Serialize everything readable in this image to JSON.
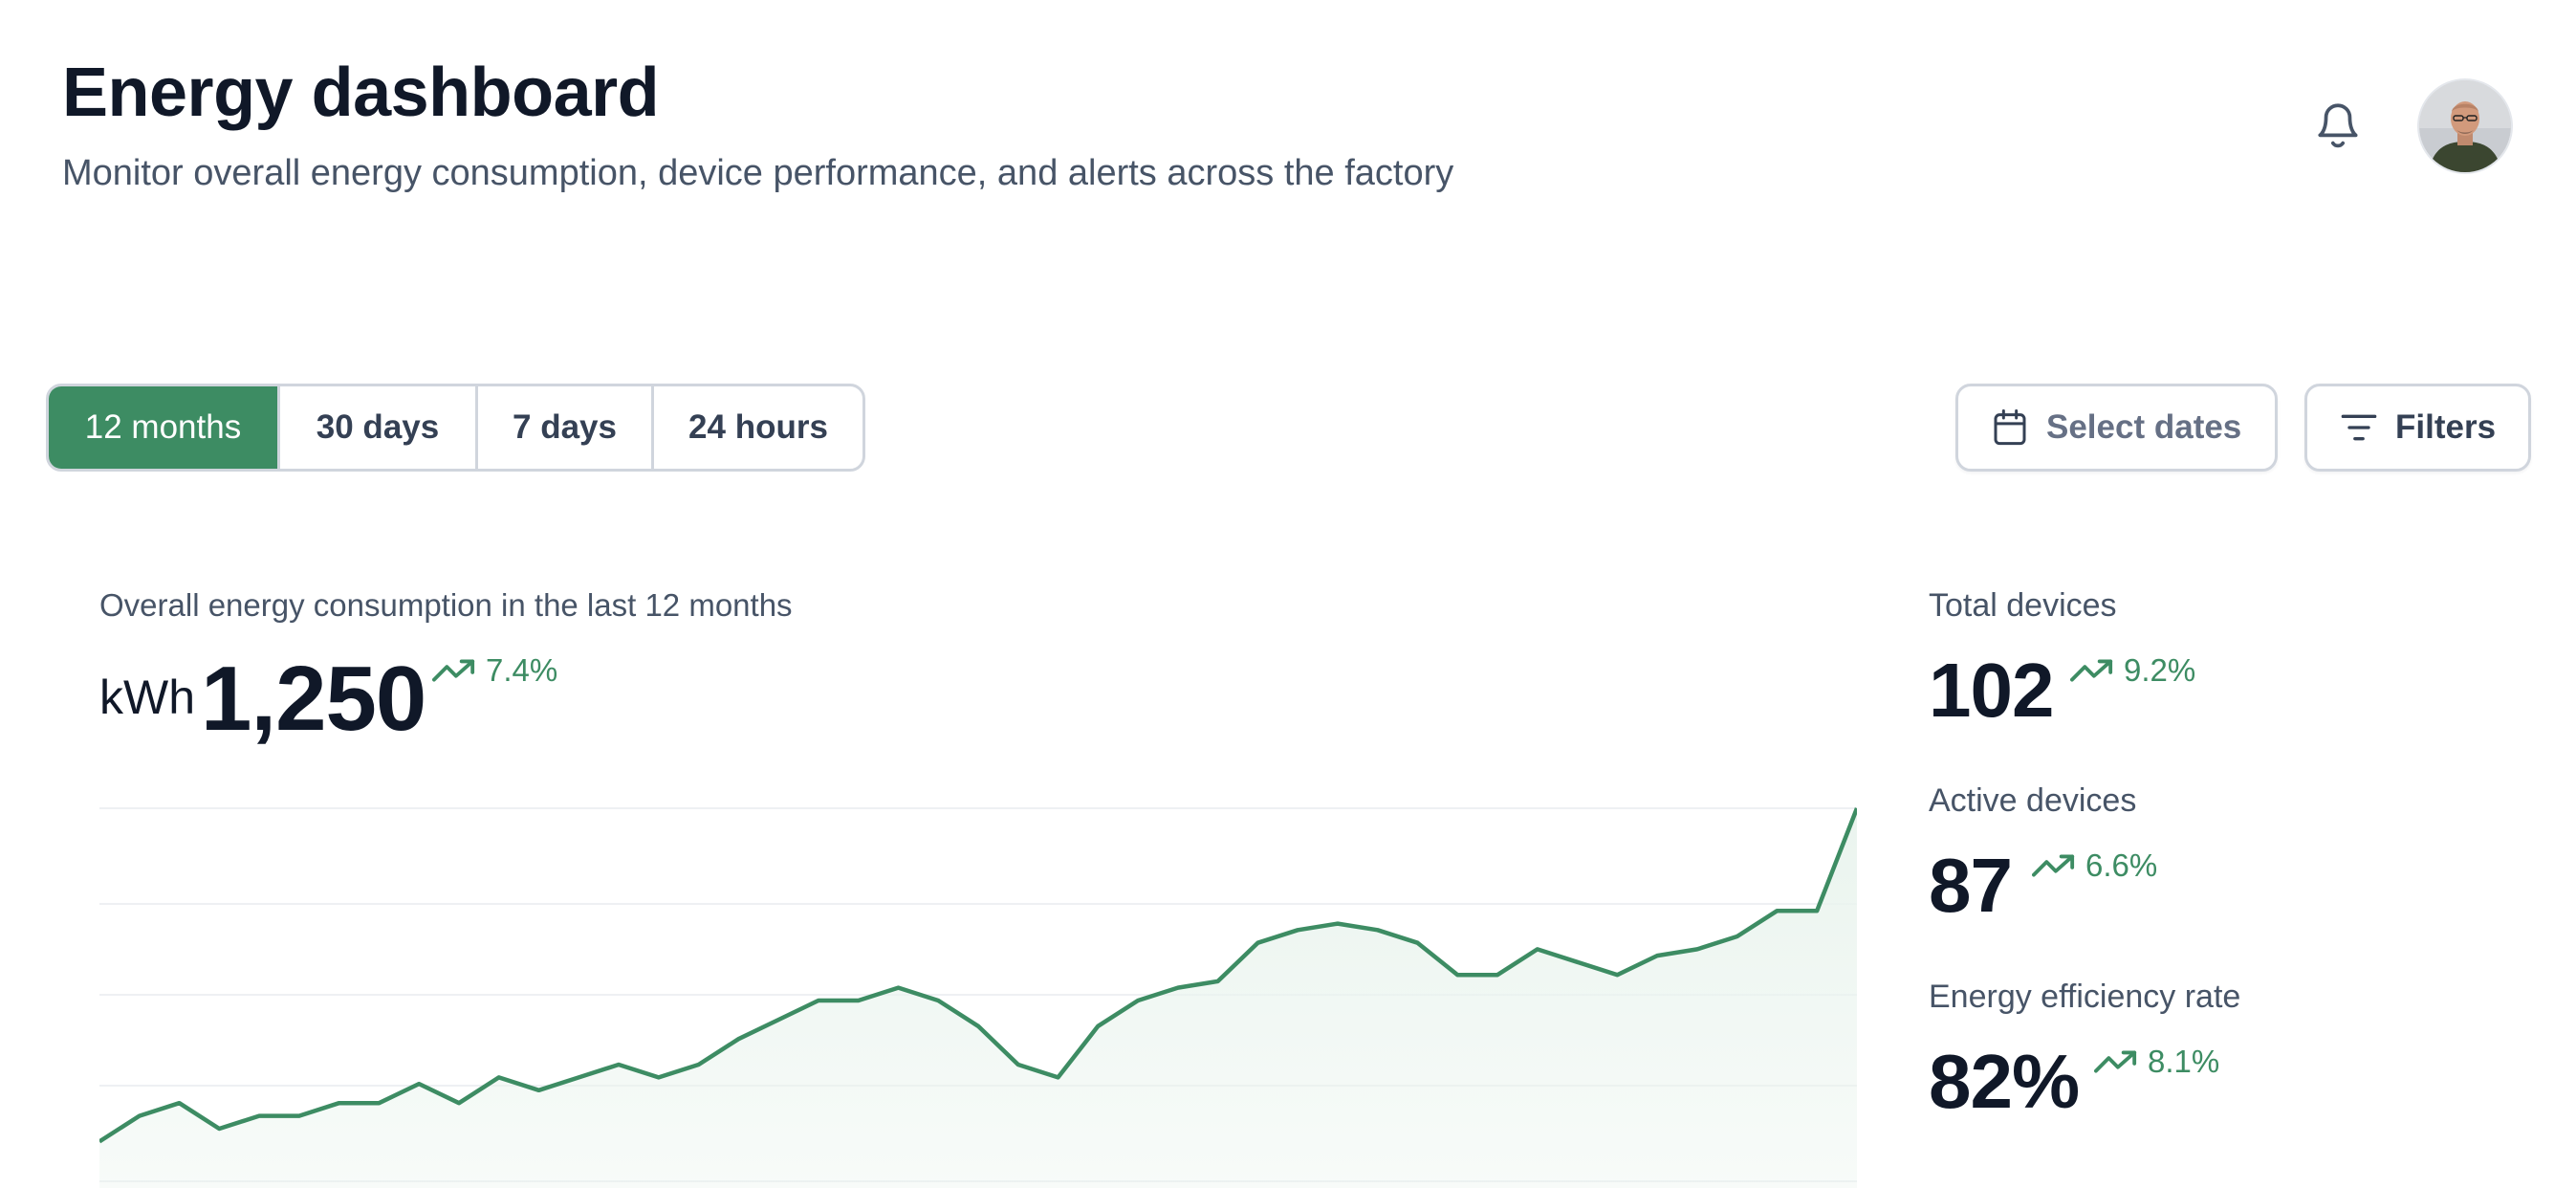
{
  "header": {
    "title": "Energy dashboard",
    "subtitle": "Monitor overall energy consumption, device performance, and alerts across the factory"
  },
  "range_tabs": [
    {
      "label": "12 months",
      "active": true
    },
    {
      "label": "30 days",
      "active": false
    },
    {
      "label": "7 days",
      "active": false
    },
    {
      "label": "24 hours",
      "active": false
    }
  ],
  "actions": {
    "select_dates": "Select dates",
    "filters": "Filters"
  },
  "energy": {
    "label": "Overall energy consumption in the last 12 months",
    "unit": "kWh",
    "value": "1,250",
    "change": "7.4%"
  },
  "stats": [
    {
      "label": "Total devices",
      "value": "102",
      "change": "9.2%"
    },
    {
      "label": "Active devices",
      "value": "87",
      "change": "6.6%"
    },
    {
      "label": "Energy efficiency rate",
      "value": "82%",
      "change": "8.1%"
    }
  ],
  "colors": {
    "accent": "#3d8c63",
    "trend_up": "#3d8c63",
    "area_fill": "#eaf4ee",
    "gridline": "#eef0f3"
  },
  "icons": {
    "notification": "bell-icon",
    "calendar": "calendar-icon",
    "filters": "filter-lines-icon",
    "trend": "trend-up-icon"
  },
  "chart_data": {
    "type": "area",
    "title": "",
    "xlabel": "",
    "ylabel": "",
    "ylim": [
      0,
      100
    ],
    "grid": true,
    "x": [
      0,
      1,
      2,
      3,
      4,
      5,
      6,
      7,
      8,
      9,
      10,
      11,
      12,
      13,
      14,
      15,
      16,
      17,
      18,
      19,
      20,
      21,
      22,
      23,
      24,
      25,
      26,
      27,
      28,
      29,
      30,
      31,
      32,
      33,
      34,
      35,
      36,
      37,
      38,
      39,
      40,
      41,
      42,
      43,
      44
    ],
    "values": [
      48,
      52,
      54,
      50,
      52,
      52,
      54,
      54,
      57,
      54,
      58,
      56,
      58,
      60,
      58,
      60,
      64,
      67,
      70,
      70,
      72,
      70,
      66,
      60,
      58,
      66,
      70,
      72,
      73,
      79,
      81,
      82,
      81,
      79,
      74,
      74,
      78,
      76,
      74,
      77,
      78,
      80,
      84,
      84,
      100
    ]
  }
}
